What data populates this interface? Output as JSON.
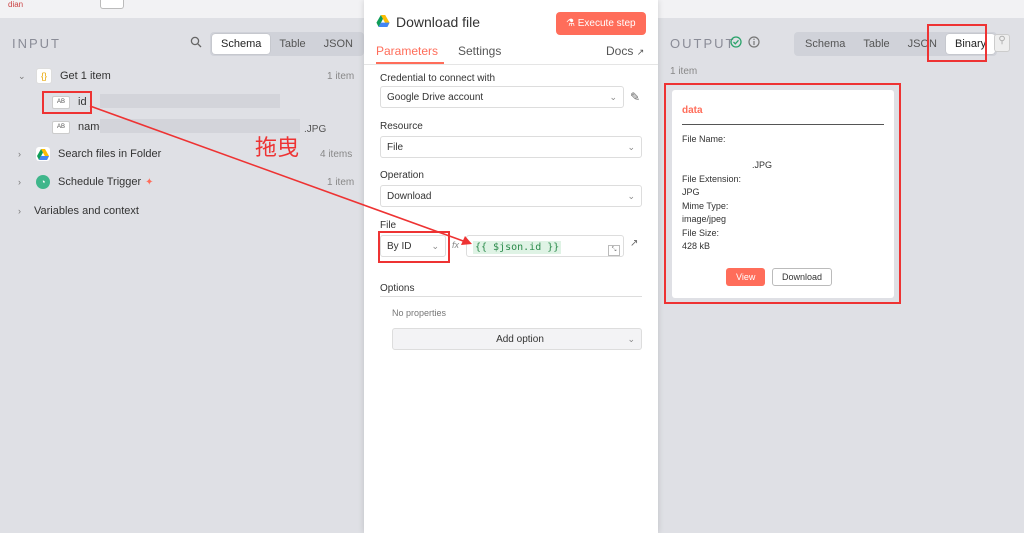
{
  "top": {
    "stub": "dian"
  },
  "input": {
    "title": "INPUT",
    "views": [
      "Schema",
      "Table",
      "JSON"
    ],
    "tree": [
      {
        "label": "Get 1 item",
        "count": "1 item"
      },
      {
        "label": "id"
      },
      {
        "label": "name",
        "value": ".JPG"
      },
      {
        "label": "Search files in Folder",
        "count": "4 items"
      },
      {
        "label": "Schedule Trigger",
        "count": "1 item"
      },
      {
        "label": "Variables and context"
      }
    ]
  },
  "annotation": {
    "drag_text": "拖曳"
  },
  "modal": {
    "title": "Download file",
    "execute": "Execute step",
    "tabs": [
      "Parameters",
      "Settings"
    ],
    "docs": "Docs",
    "credential_label": "Credential to connect with",
    "credential_value": "Google Drive account",
    "resource_label": "Resource",
    "resource_value": "File",
    "operation_label": "Operation",
    "operation_value": "Download",
    "file_label": "File",
    "file_mode": "By ID",
    "fx": "fx",
    "file_expr": "{{ $json.id }}",
    "options_label": "Options",
    "no_props": "No properties",
    "add_option": "Add option"
  },
  "output": {
    "title": "OUTPUT",
    "views": [
      "Schema",
      "Table",
      "JSON",
      "Binary"
    ],
    "count": "1 item",
    "card": {
      "name": "data",
      "file_name_label": "File Name:",
      "file_name_value": ".JPG",
      "ext_label": "File Extension:",
      "ext_value": "JPG",
      "mime_label": "Mime Type:",
      "mime_value": "image/jpeg",
      "size_label": "File Size:",
      "size_value": "428 kB",
      "view": "View",
      "download": "Download"
    }
  },
  "colors": {
    "accent": "#ff6d5a",
    "annotation": "#e33333"
  }
}
